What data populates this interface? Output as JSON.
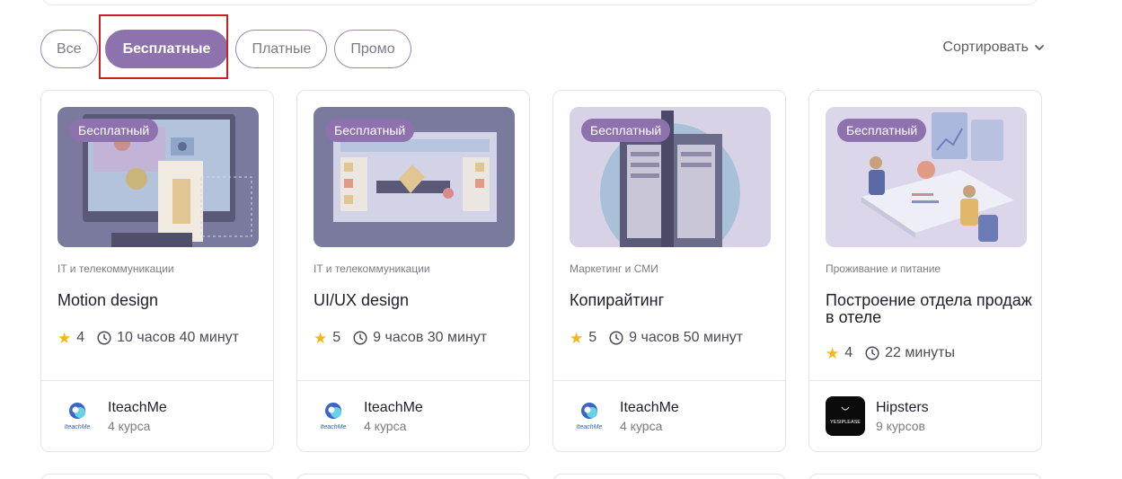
{
  "filters": [
    {
      "label": "Все",
      "active": false
    },
    {
      "label": "Бесплатные",
      "active": true
    },
    {
      "label": "Платные",
      "active": false
    },
    {
      "label": "Промо",
      "active": false
    }
  ],
  "sort": {
    "label": "Сортировать"
  },
  "cards": [
    {
      "badge": "Бесплатный",
      "category": "IT и телекоммуникации",
      "title": "Motion design",
      "rating": "4",
      "duration": "10 часов 40 минут",
      "author": "IteachMe",
      "courses": "4 курса"
    },
    {
      "badge": "Бесплатный",
      "category": "IT и телекоммуникации",
      "title": "UI/UX design",
      "rating": "5",
      "duration": "9 часов 30 минут",
      "author": "IteachMe",
      "courses": "4 курса"
    },
    {
      "badge": "Бесплатный",
      "category": "Маркетинг и СМИ",
      "title": "Копирайтинг",
      "rating": "5",
      "duration": "9 часов 50 минут",
      "author": "IteachMe",
      "courses": "4 курса"
    },
    {
      "badge": "Бесплатный",
      "category": "Проживание и питание",
      "title": "Построение отдела продаж в отеле",
      "rating": "4",
      "duration": "22 минуты",
      "author": "Hipsters",
      "courses": "9 курсов"
    }
  ],
  "logos": {
    "iteachme_text": "IteachMe",
    "hipsters_text": "YESIPLEASE"
  },
  "colors": {
    "accent": "#8d72ad",
    "star": "#f4b61a",
    "highlight": "#cc1f1f"
  }
}
